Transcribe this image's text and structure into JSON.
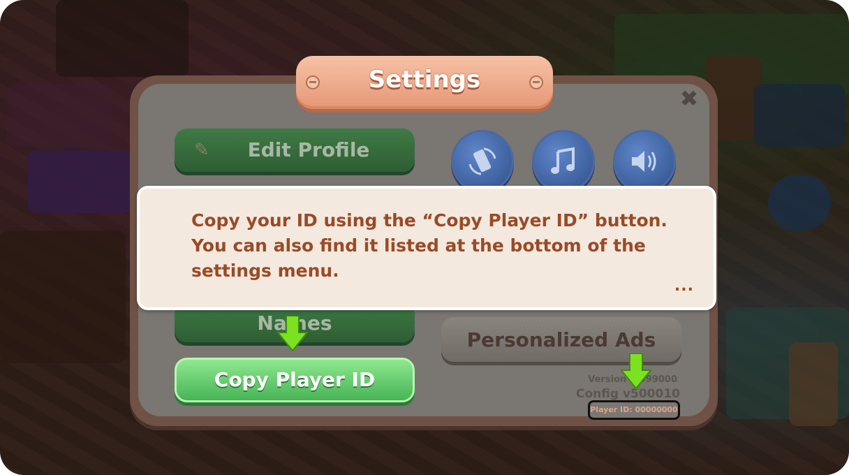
{
  "dialog": {
    "title": "Settings",
    "close_label": "✖"
  },
  "buttons": {
    "edit_profile": "Edit Profile",
    "names": "Names",
    "copy_player_id": "Copy Player ID",
    "personalized_ads": "Personalized Ads"
  },
  "toggles": [
    {
      "name": "rotate",
      "icon": "rotate-phone-icon"
    },
    {
      "name": "music",
      "icon": "music-note-icon"
    },
    {
      "name": "sound",
      "icon": "speaker-icon"
    }
  ],
  "tooltip": {
    "line1": "Copy your ID using the “Copy Player ID” button.",
    "line2": "You can also find it listed at the bottom of the",
    "line3": "settings menu.",
    "more": "..."
  },
  "footer": {
    "version": "Version 4.999000",
    "config": "Config v500010",
    "player_id": "Player ID: 00000000"
  },
  "colors": {
    "accent_green": "#47b456",
    "title_plate": "#e59776",
    "tooltip_text": "#9a4a27",
    "arrow": "#7ce21f"
  }
}
